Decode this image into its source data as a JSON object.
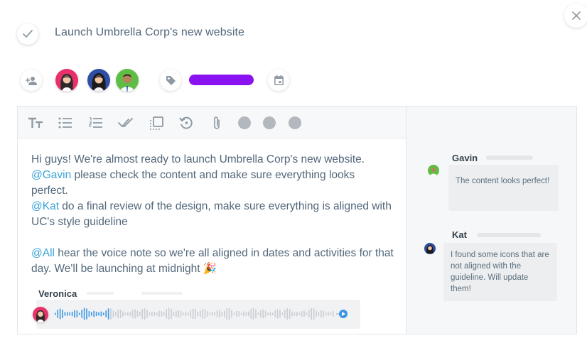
{
  "task": {
    "title": "Launch Umbrella Corp's new website"
  },
  "colors": {
    "accent_purple": "#8a12f0",
    "mention_blue": "#3aa3d9",
    "waveform_blue": "#3b97e3",
    "icon_gray": "#8d9aa4"
  },
  "assignees": [
    {
      "name": "Veronica",
      "icon": "avatar-woman-red-icon"
    },
    {
      "name": "Kat",
      "icon": "avatar-woman-blue-icon"
    },
    {
      "name": "Gavin",
      "icon": "avatar-man-green-icon"
    }
  ],
  "toolbar": {
    "icons": [
      "text-size-icon",
      "bullet-list-icon",
      "numbered-list-icon",
      "double-check-icon",
      "checkbox-list-icon",
      "history-icon",
      "attachment-icon"
    ]
  },
  "message": {
    "line1": "Hi guys! We're almost ready to launch Umbrella Corp's new website.",
    "mention1": "@Gavin",
    "text1": " please check the content and make sure everything looks perfect.",
    "mention2": "@Kat",
    "text2": " do a final review of the design, make sure everything is aligned with UC's style guideline",
    "mention3": "@All",
    "text3": " hear the voice note so we're all aligned in dates and activities for that day. We'll be launching at midnight 🎉"
  },
  "voice_note": {
    "author": "Veronica",
    "progress": 0.19
  },
  "comments": [
    {
      "author": "Gavin",
      "text": "The content looks perfect!"
    },
    {
      "author": "Kat",
      "text": "I found some icons that are not aligned with the guideline. Will update them!"
    }
  ]
}
